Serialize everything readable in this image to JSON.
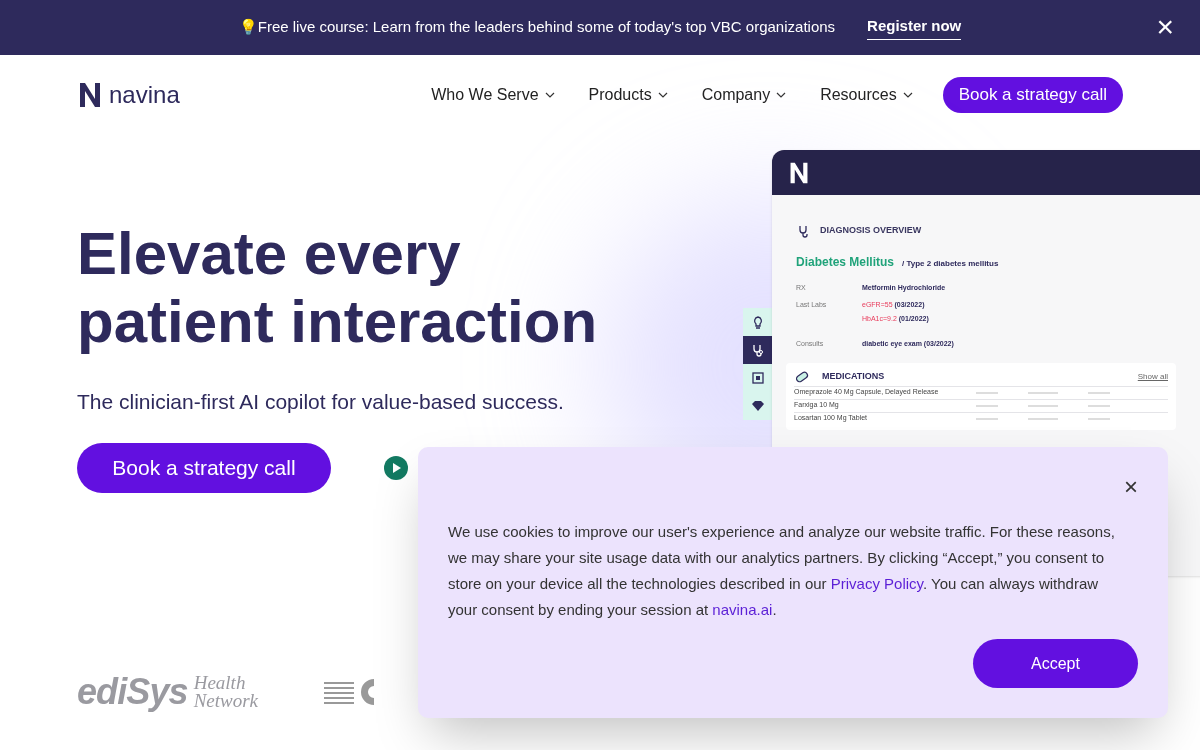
{
  "announcement": {
    "emoji": "💡",
    "text": "Free live course: Learn from the leaders behind some of today's top VBC organizations",
    "link": "Register now",
    "close": "×"
  },
  "nav": {
    "logo": "navina",
    "items": [
      {
        "label": "Who We Serve"
      },
      {
        "label": "Products"
      },
      {
        "label": "Company"
      },
      {
        "label": "Resources"
      }
    ],
    "cta": "Book a strategy call"
  },
  "hero": {
    "title": "Elevate every patient interaction",
    "subtitle": "The clinician-first AI copilot for value-based success.",
    "cta": "Book a strategy call"
  },
  "mockup": {
    "side_icons": [
      {
        "kind": "bulb",
        "selected": false
      },
      {
        "kind": "stethoscope",
        "selected": true
      },
      {
        "kind": "document",
        "selected": false
      },
      {
        "kind": "diamond",
        "selected": false
      }
    ],
    "section_title": "DIAGNOSIS OVERVIEW",
    "diagnosis": "Diabetes Mellitus",
    "diagnosis_detail": "/ Type 2 diabetes mellitus",
    "facts": [
      {
        "label": "RX",
        "values": [
          {
            "rest": "Metformin Hydrochloride"
          }
        ]
      },
      {
        "label": "Last Labs",
        "values": [
          {
            "flag": "eGFR=55",
            "rest": "(03/2022)"
          },
          {
            "flag": "HbA1c=9.2",
            "rest": "(01/2022)"
          }
        ]
      },
      {
        "label": "Consults",
        "values": [
          {
            "rest": "diabetic eye exam (03/2022)"
          }
        ]
      }
    ],
    "medications_title": "MEDICATIONS",
    "show_all": "Show all",
    "medications": [
      "Omeprazole 40 Mg Capsule, Delayed Release",
      "Farxiga 10 Mg",
      "Losartan 100 Mg Tablet"
    ]
  },
  "logos": [
    {
      "name": "ediSys",
      "tagline": "Health Network"
    }
  ],
  "cookie": {
    "close": "×",
    "text": "We use cookies to improve our user's experience and analyze our website traffic. For these reasons, we may share your site usage data with our analytics partners. By clicking “Accept,” you consent to store on your device all the technologies described in our ",
    "link": "Privacy Policy",
    "text2": ". You can always withdraw your consent by ending your session at ",
    "link2": "navina.ai",
    "text3": ".",
    "accept": "Accept"
  }
}
